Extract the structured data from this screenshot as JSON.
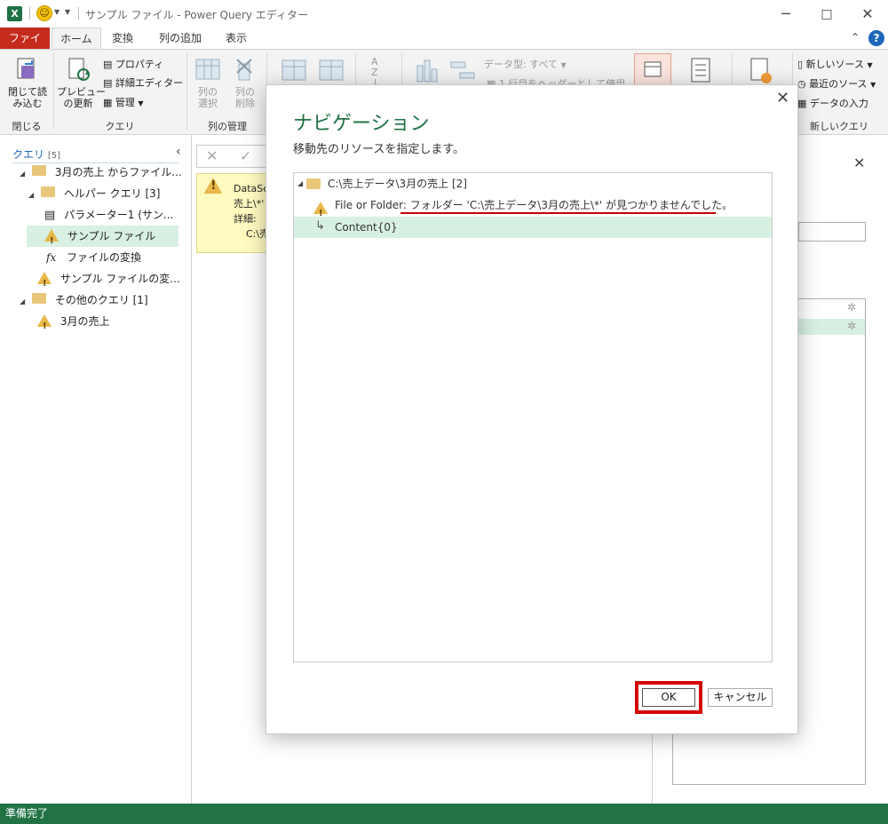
{
  "window": {
    "title": "サンプル ファイル - Power Query エディター",
    "minimize": "─",
    "restore": "□",
    "close": "✕"
  },
  "tabs": [
    "ファイル",
    "ホーム",
    "変換",
    "列の追加",
    "表示"
  ],
  "ribbon": {
    "close_load": "閉じて読\nみ込む",
    "preview_refresh": "プレビュー\nの更新",
    "properties": "プロパティ",
    "advanced_editor": "詳細エディター",
    "manage": "管理",
    "choose_columns": "列の\n選択",
    "remove_columns": "列の\n削除",
    "data_type": "データ型: すべて",
    "first_row_header": "1 行目をヘッダーとして使用",
    "new_source": "新しいソース",
    "recent_sources": "最近のソース",
    "enter_data": "データの入力",
    "groups": {
      "close": "閉じる",
      "query": "クエリ",
      "manage_columns": "列の管理",
      "new_query": "新しいクエリ"
    }
  },
  "queries": {
    "header": "クエリ",
    "count": "[5]",
    "items": [
      "3月の売上 からファイル...",
      "ヘルパー クエリ [3]",
      "パラメーター1 (サン...",
      "サンプル ファイル",
      "ファイルの変換",
      "サンプル ファイルの変...",
      "その他のクエリ [1]",
      "3月の売上"
    ]
  },
  "error_panel": {
    "line1": "DataSc",
    "line2": "売上\\*'",
    "line3": "詳細:",
    "line4": "C:\\売"
  },
  "dialog": {
    "title": "ナビゲーション",
    "subtitle": "移動先のリソースを指定します。",
    "root_label": "C:\\売上データ\\3月の売上 [2]",
    "error_prefix": "File or Folder: ",
    "error_message": "フォルダー 'C:\\売上データ\\3月の売上\\*' が見つかりませんでした。",
    "content_label": "Content{0}",
    "ok": "OK",
    "cancel": "キャンセル"
  },
  "status": "準備完了",
  "colors": {
    "excel_green": "#217346",
    "file_tab_red": "#c42b1c",
    "highlight_red": "#d40000",
    "selection": "#d8f0e2"
  }
}
